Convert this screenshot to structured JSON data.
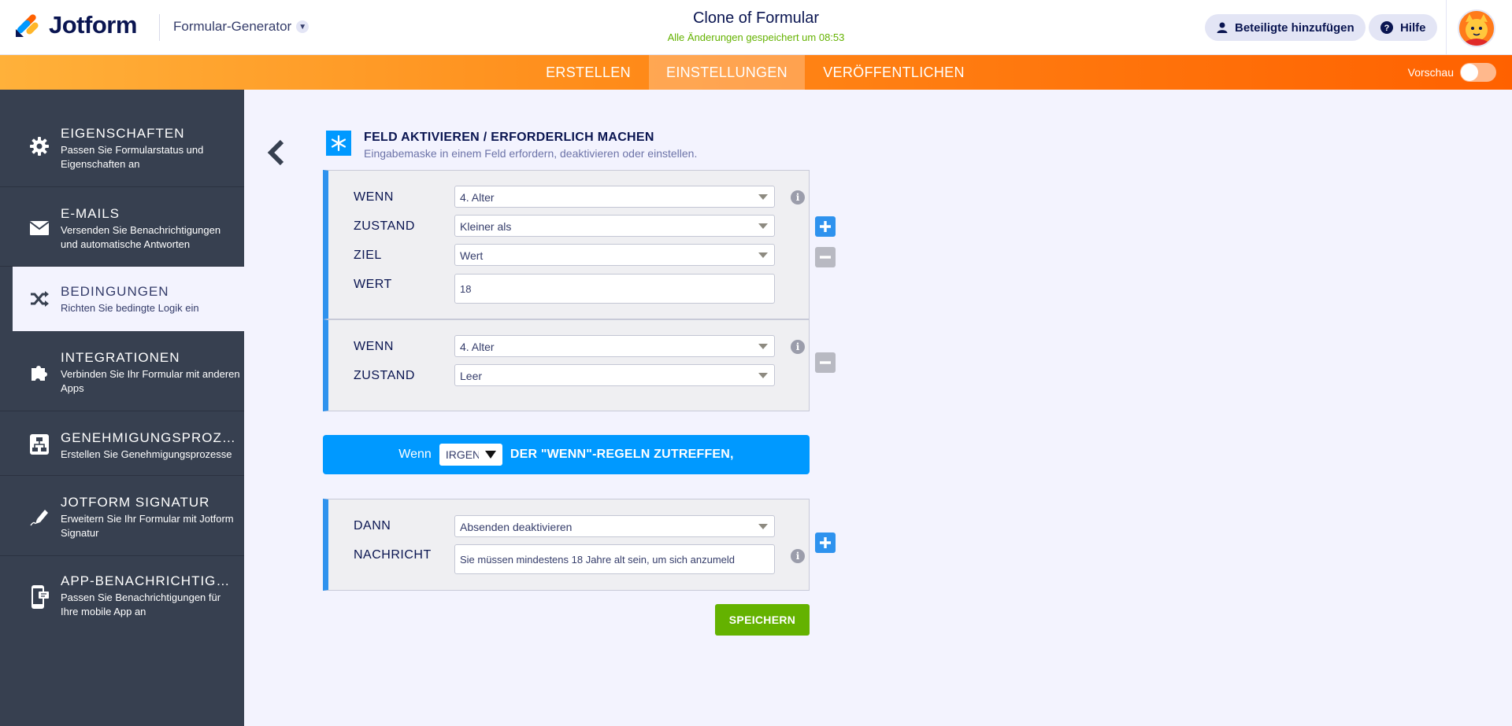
{
  "app": {
    "brand": "Jotform",
    "builder_menu": "Formular-Generator"
  },
  "header": {
    "form_title": "Clone of Formular",
    "saved_status": "Alle Änderungen gespeichert um 08:53",
    "add_collaborators": "Beteiligte hinzufügen",
    "help": "Hilfe"
  },
  "nav": {
    "tabs": [
      {
        "label": "ERSTELLEN"
      },
      {
        "label": "EINSTELLUNGEN"
      },
      {
        "label": "VERÖFFENTLICHEN"
      }
    ],
    "preview_label": "Vorschau"
  },
  "sidebar": {
    "items": [
      {
        "title": "EIGENSCHAFTEN",
        "desc": "Passen Sie Formularstatus und Eigenschaften an",
        "icon": "gear-icon"
      },
      {
        "title": "E-MAILS",
        "desc": "Versenden Sie Benachrichtigungen und automatische Antworten",
        "icon": "envelope-icon"
      },
      {
        "title": "BEDINGUNGEN",
        "desc": "Richten Sie bedingte Logik ein",
        "icon": "shuffle-icon"
      },
      {
        "title": "INTEGRATIONEN",
        "desc": "Verbinden Sie Ihr Formular mit anderen Apps",
        "icon": "puzzle-icon"
      },
      {
        "title": "GENEHMIGUNGSPROZES...",
        "desc": "Erstellen Sie Genehmigungsprozesse",
        "icon": "flow-icon"
      },
      {
        "title": "JOTFORM SIGNATUR",
        "desc": "Erweitern Sie Ihr Formular mit Jotform Signatur",
        "icon": "pen-icon"
      },
      {
        "title": "APP-BENACHRICHTIGUNG",
        "desc": "Passen Sie Benachrichtigungen für Ihre mobile App an",
        "icon": "mobile-icon"
      }
    ]
  },
  "condition": {
    "title": "FELD AKTIVIEREN / ERFORDERLICH MACHEN",
    "subtitle": "Eingabemaske in einem Feld erfordern, deaktivieren oder einstellen.",
    "rule1": {
      "if_label": "WENN",
      "if_value": "4. Alter",
      "state_label": "ZUSTAND",
      "state_value": "Kleiner als",
      "target_label": "ZIEL",
      "target_value": "Wert",
      "value_label": "WERT",
      "value_value": "18"
    },
    "rule2": {
      "if_label": "WENN",
      "if_value": "4. Alter",
      "state_label": "ZUSTAND",
      "state_value": "Leer"
    },
    "any_bar": {
      "prefix": "Wenn",
      "select_value": "IRGENDEINE",
      "suffix": "DER \"WENN\"-REGELN ZUTREFFEN,"
    },
    "action": {
      "then_label": "DANN",
      "then_value": "Absenden deaktivieren",
      "message_label": "NACHRICHT",
      "message_value": "Sie müssen mindestens 18 Jahre alt sein, um sich anzumeld"
    },
    "save_label": "SPEICHERN"
  },
  "colors": {
    "accent_orange": "#ff6100",
    "accent_blue": "#0099ff",
    "sidebar_bg": "#374050",
    "save_green": "#64b200"
  }
}
